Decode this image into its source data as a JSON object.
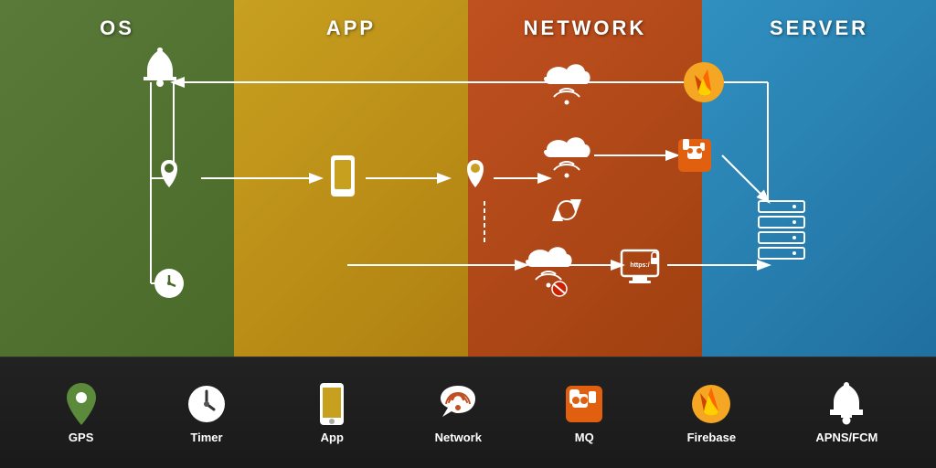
{
  "columns": [
    {
      "id": "os",
      "label": "OS",
      "color": "#5a7a3a"
    },
    {
      "id": "app",
      "label": "APP",
      "color": "#c8a020"
    },
    {
      "id": "network",
      "label": "NETWORK",
      "color": "#c05020"
    },
    {
      "id": "server",
      "label": "SERVER",
      "color": "#3090c0"
    }
  ],
  "legend": [
    {
      "id": "gps",
      "label": "GPS"
    },
    {
      "id": "timer",
      "label": "Timer"
    },
    {
      "id": "app",
      "label": "App"
    },
    {
      "id": "network",
      "label": "Network"
    },
    {
      "id": "mq",
      "label": "MQ"
    },
    {
      "id": "firebase",
      "label": "Firebase"
    },
    {
      "id": "apns",
      "label": "APNS/FCM"
    }
  ],
  "colors": {
    "os_bg": "#4a6a2a",
    "app_bg": "#b89020",
    "network_bg": "#a04010",
    "server_bg": "#2878a8",
    "white": "#ffffff",
    "orange_icon": "#e06010",
    "firebase_orange": "#f5a623",
    "line_color": "#ffffff"
  }
}
